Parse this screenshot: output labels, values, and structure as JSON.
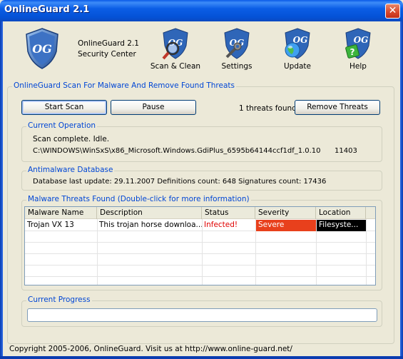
{
  "window": {
    "title": "OnlineGuard 2.1"
  },
  "header": {
    "app_name": "OnlineGuard 2.1",
    "app_subtitle": "Security Center",
    "toolbar": [
      {
        "label": "Scan & Clean",
        "icon": "shield-magnifier-icon"
      },
      {
        "label": "Settings",
        "icon": "shield-wrench-icon"
      },
      {
        "label": "Update",
        "icon": "shield-globe-icon"
      },
      {
        "label": "Help",
        "icon": "shield-question-icon"
      }
    ]
  },
  "scan": {
    "group_title": "OnlineGuard Scan For Malware And Remove Found Threats",
    "start_label": "Start Scan",
    "pause_label": "Pause",
    "threats_found": "1 threats found",
    "remove_label": "Remove Threats"
  },
  "current_operation": {
    "title": "Current Operation",
    "status": "Scan complete. Idle.",
    "path": "C:\\WINDOWS\\WinSxS\\x86_Microsoft.Windows.GdiPlus_6595b64144ccf1df_1.0.10",
    "count": "11403"
  },
  "database": {
    "title": "Antimalware Database",
    "info": "Database last update: 29.11.2007 Definitions count: 648 Signatures count: 17436"
  },
  "threats": {
    "title": "Malware Threats Found (Double-click for more information)",
    "columns": [
      "Malware Name",
      "Description",
      "Status",
      "Severity",
      "Location"
    ],
    "rows": [
      {
        "name": "Trojan VX 13",
        "description": "This trojan horse downloa...",
        "status": "Infected!",
        "severity": "Severe",
        "location": "Filesyste..."
      }
    ]
  },
  "progress": {
    "title": "Current Progress",
    "value": 0
  },
  "footer": {
    "copyright": "Copyright 2005-2006, OnlineGuard. Visit us at http://www.online-guard.net/"
  },
  "colors": {
    "titlebar": "#0A5AE8",
    "legend": "#0046D5",
    "infected_text": "#E00000",
    "severe_bg": "#E8401C",
    "location_bg": "#000000"
  }
}
